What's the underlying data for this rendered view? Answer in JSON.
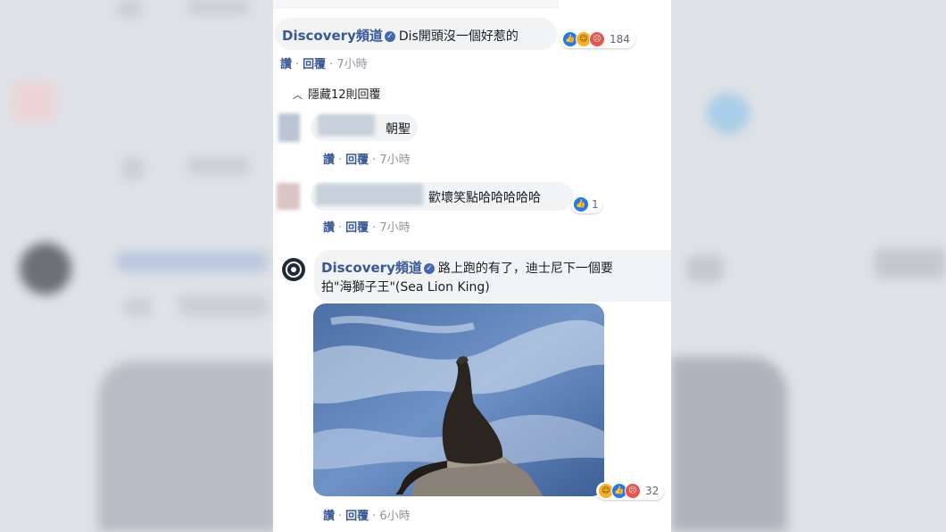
{
  "comment1": {
    "author": "Discovery頻道",
    "text": "Dis開頭沒一個好惹的",
    "reactions_count": "184",
    "actions": {
      "like": "讚",
      "reply": "回覆",
      "time": "7小時"
    }
  },
  "hidden_replies": {
    "label": "隱藏12則回覆"
  },
  "reply1": {
    "text": "朝聖",
    "actions": {
      "like": "讚",
      "reply": "回覆",
      "time": "7小時"
    }
  },
  "reply2": {
    "text": "歡壞笑點哈哈哈哈哈",
    "reactions_count": "1",
    "actions": {
      "like": "讚",
      "reply": "回覆",
      "time": "7小時"
    }
  },
  "comment2": {
    "author": "Discovery頻道",
    "text_line1": "路上跑的有了，迪士尼下一個要",
    "text_line2": "拍\"海獅子王\"(Sea Lion King)",
    "reactions_count": "32",
    "actions": {
      "like": "讚",
      "reply": "回覆",
      "time": "6小時"
    }
  },
  "icons": [
    "verified-badge-icon",
    "like-reaction-icon",
    "haha-reaction-icon",
    "angry-reaction-icon",
    "caret-up-icon",
    "discovery-logo-icon"
  ],
  "colors": {
    "link": "#385898",
    "bubble": "#f2f3f5",
    "like": "#2078f4",
    "haha": "#f7b125",
    "angry": "#e9544f",
    "muted": "#90949c"
  }
}
